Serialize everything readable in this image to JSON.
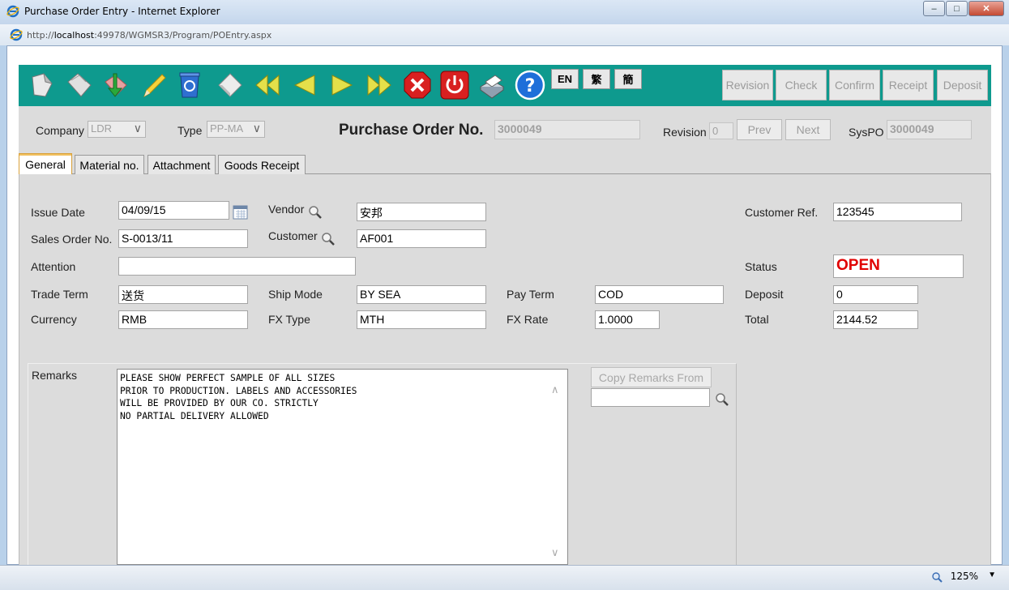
{
  "window": {
    "title": "Purchase Order Entry - Internet Explorer",
    "url_prefix": "http://",
    "url_host": "localhost",
    "url_rest": ":49978/WGMSR3/Program/POEntry.aspx",
    "minimize": "–",
    "maximize": "□",
    "close": "✕",
    "zoom": "125%"
  },
  "toolbar": {
    "icons": [
      "new-doc-icon",
      "copy-doc-icon",
      "import-icon",
      "edit-pencil-icon",
      "recycle-bin-icon",
      "eraser-icon",
      "first-record-icon",
      "previous-record-icon",
      "next-record-icon",
      "last-record-icon",
      "cancel-icon",
      "exit-power-icon",
      "print-icon",
      "help-icon"
    ],
    "lang_en": "EN",
    "lang_tc": "繁",
    "lang_sc": "簡",
    "workflow": [
      "Revision",
      "Check",
      "Confirm",
      "Receipt",
      "Deposit"
    ]
  },
  "header": {
    "company_label": "Company",
    "company_value": "LDR",
    "type_label": "Type",
    "type_value": "PP-MA",
    "po_title": "Purchase Order No.",
    "po_number": "3000049",
    "revision_label": "Revision",
    "revision_value": "0",
    "prev_label": "Prev",
    "next_label": "Next",
    "syspo_label": "SysPO",
    "syspo_value": "3000049"
  },
  "tabs": [
    "General",
    "Material no.",
    "Attachment",
    "Goods Receipt"
  ],
  "form": {
    "issue_date_label": "Issue Date",
    "issue_date": "04/09/15",
    "vendor_label": "Vendor",
    "vendor": "安邦",
    "customer_ref_label": "Customer Ref.",
    "customer_ref": "123545",
    "sales_order_label": "Sales Order No.",
    "sales_order": "S-0013/11",
    "customer_label": "Customer",
    "customer": "AF001",
    "attention_label": "Attention",
    "attention": "",
    "status_label": "Status",
    "status": "OPEN",
    "trade_term_label": "Trade Term",
    "trade_term": "送货",
    "ship_mode_label": "Ship Mode",
    "ship_mode": "BY SEA",
    "pay_term_label": "Pay Term",
    "pay_term": "COD",
    "deposit_label": "Deposit",
    "deposit": "0",
    "currency_label": "Currency",
    "currency": "RMB",
    "fx_type_label": "FX Type",
    "fx_type": "MTH",
    "fx_rate_label": "FX Rate",
    "fx_rate": "1.0000",
    "total_label": "Total",
    "total": "2144.52",
    "remarks_label": "Remarks",
    "remarks": "PLEASE SHOW PERFECT SAMPLE OF ALL SIZES\nPRIOR TO PRODUCTION. LABELS AND ACCESSORIES\nWILL BE PROVIDED BY OUR CO. STRICTLY\nNO PARTIAL DELIVERY ALLOWED",
    "copy_remarks_label": "Copy Remarks From",
    "copy_remarks_value": ""
  },
  "colors": {
    "toolbar": "#0e9a8e",
    "status_open": "#e00000",
    "tab_active_border": "#d9a13a"
  }
}
